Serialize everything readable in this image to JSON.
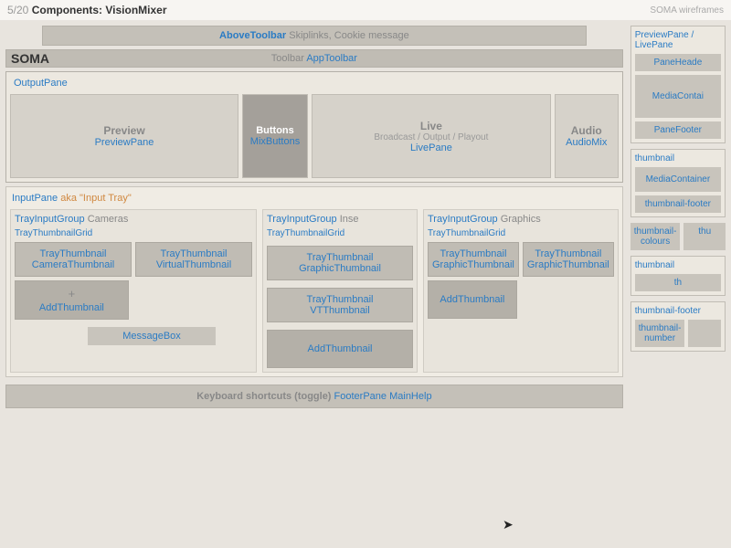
{
  "topbar": {
    "page_frac": "5/20",
    "title_prefix": "Components:",
    "title": "VisionMixer",
    "brand": "SOMA wireframes"
  },
  "aboveToolbar": {
    "label": "AboveToolbar",
    "desc": "Skiplinks, Cookie message"
  },
  "toolbar": {
    "prefix": "Toolbar",
    "label": "AppToolbar"
  },
  "soma": "SOMA",
  "outputPane": {
    "label": "OutputPane",
    "preview": {
      "title": "Preview",
      "label": "PreviewPane"
    },
    "buttons": {
      "title": "Buttons",
      "label": "MixButtons"
    },
    "live": {
      "title": "Live",
      "sub": "Broadcast / Output / Playout",
      "label": "LivePane"
    },
    "audio": {
      "title": "Audio",
      "label": "AudioMix"
    }
  },
  "inputPane": {
    "label": "InputPane",
    "aka": "aka \"Input Tray\"",
    "cameras": {
      "groupLabel": "TrayInputGroup",
      "groupName": "Cameras",
      "gridLabel": "TrayThumbnailGrid",
      "thumb1a": "TrayThumbnail",
      "thumb1b": "CameraThumbnail",
      "thumb2a": "TrayThumbnail",
      "thumb2b": "VirtualThumbnail",
      "addLabel": "AddThumbnail"
    },
    "inserts": {
      "groupLabel": "TrayInputGroup",
      "groupName": "Inse",
      "gridLabel": "TrayThumbnailGrid",
      "thumb1a": "TrayThumbnail",
      "thumb1b": "GraphicThumbnail",
      "thumb2a": "TrayThumbnail",
      "thumb2b": "VTThumbnail",
      "addLabel": "AddThumbnail"
    },
    "graphics": {
      "groupLabel": "TrayInputGroup",
      "groupName": "Graphics",
      "gridLabel": "TrayThumbnailGrid",
      "thumb1a": "TrayThumbnail",
      "thumb1b": "GraphicThumbnail",
      "thumb2a": "TrayThumbnail",
      "thumb2b": "GraphicThumbnail",
      "addLabel": "AddThumbnail"
    },
    "messageBox": "MessageBox"
  },
  "footer": {
    "prefix": "Keyboard shortcuts (toggle)",
    "label1": "FooterPane",
    "label2": "MainHelp"
  },
  "side": {
    "previewLive": {
      "label": "PreviewPane / LivePane",
      "header": "PaneHeade",
      "media": "MediaContai",
      "footer": "PaneFooter"
    },
    "thumbnail": {
      "label": "thumbnail",
      "media": "MediaContainer",
      "footer": "thumbnail-footer",
      "colours": "thumbnail-colours",
      "thu": "thu"
    },
    "thumbnail2": {
      "label": "thumbnail",
      "th": "th"
    },
    "thumbFooter": {
      "label": "thumbnail-footer",
      "number": "thumbnail-\nnumber"
    }
  }
}
